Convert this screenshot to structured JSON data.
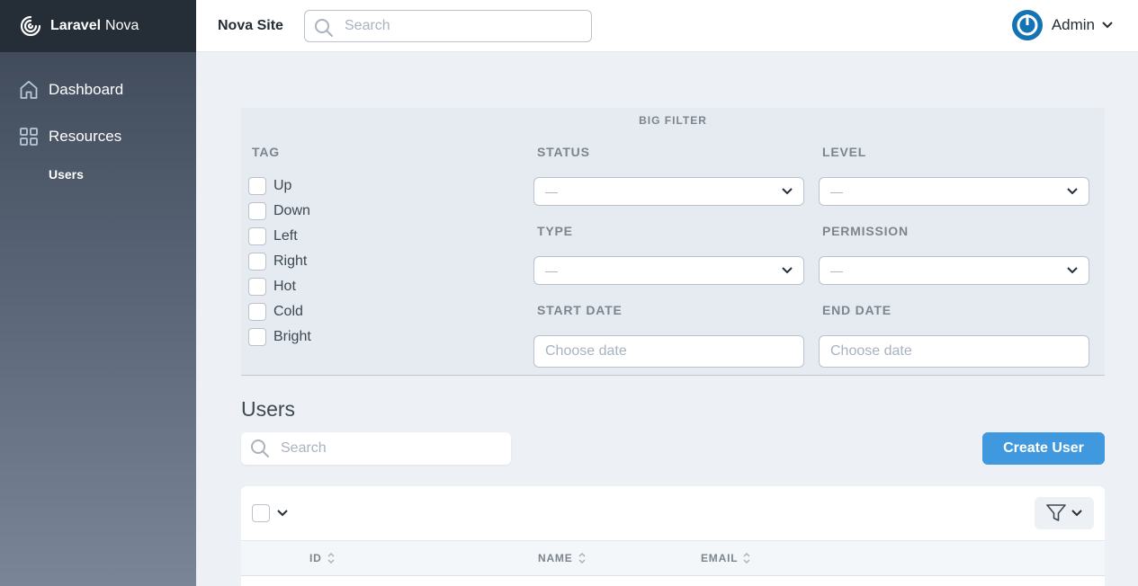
{
  "brand": {
    "name_bold": "Laravel",
    "name_rest": "Nova"
  },
  "sidebar": {
    "items": [
      {
        "label": "Dashboard",
        "icon": "home-icon"
      },
      {
        "label": "Resources",
        "icon": "grid-icon"
      }
    ],
    "sub_items": [
      {
        "label": "Users"
      }
    ]
  },
  "header": {
    "site_name": "Nova Site",
    "search_placeholder": "Search",
    "user_name": "Admin"
  },
  "filters": {
    "title": "BIG FILTER",
    "tag": {
      "label": "TAG",
      "options": [
        "Up",
        "Down",
        "Left",
        "Right",
        "Hot",
        "Cold",
        "Bright"
      ]
    },
    "status": {
      "label": "STATUS",
      "value": "—"
    },
    "level": {
      "label": "LEVEL",
      "value": "—"
    },
    "type": {
      "label": "TYPE",
      "value": "—"
    },
    "permission": {
      "label": "PERMISSION",
      "value": "—"
    },
    "start_date": {
      "label": "START DATE",
      "placeholder": "Choose date"
    },
    "end_date": {
      "label": "END DATE",
      "placeholder": "Choose date"
    }
  },
  "resource": {
    "title": "Users",
    "search_placeholder": "Search",
    "create_label": "Create User",
    "columns": [
      "ID",
      "NAME",
      "EMAIL"
    ]
  },
  "colors": {
    "accent": "#4099de",
    "sidebar_dark": "#252d37",
    "logo_blue": "#1473b5"
  }
}
